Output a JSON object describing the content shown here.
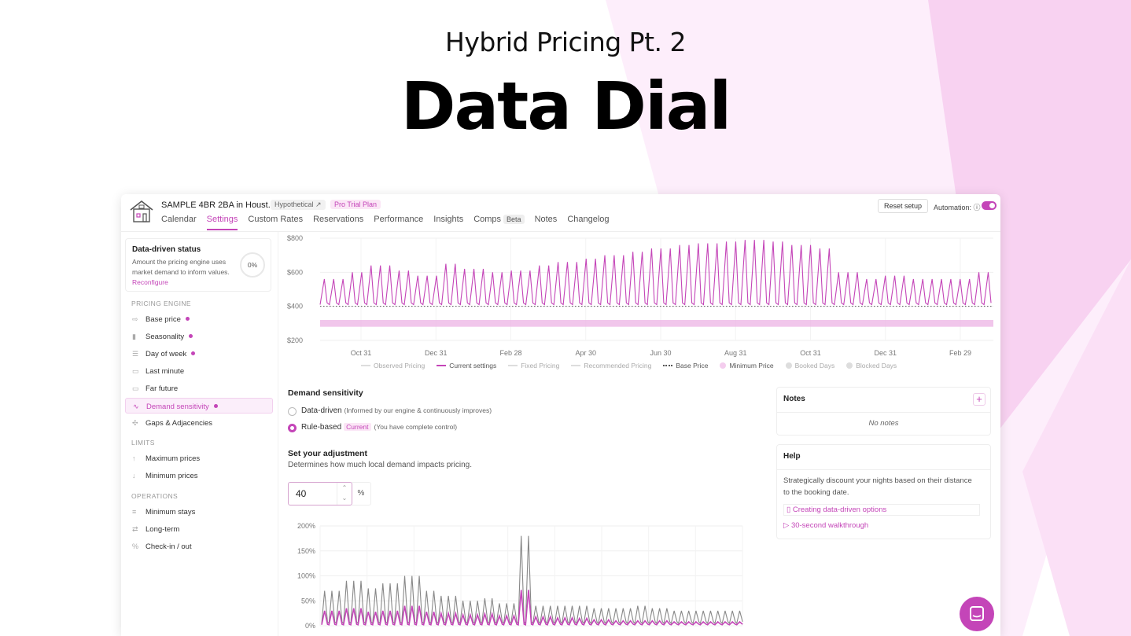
{
  "hero": {
    "subtitle": "Hybrid Pricing Pt. 2",
    "title": "Data Dial"
  },
  "colors": {
    "accent": "#c445b8",
    "accent_light": "#fbe6f6",
    "shape_light": "#fde8f8",
    "shape_mid": "#f7c8ef"
  },
  "header": {
    "property_title": "SAMPLE 4BR 2BA in Houst...",
    "badge_hypothetical": "Hypothetical",
    "badge_plan": "Pro Trial Plan",
    "reset_label": "Reset setup",
    "automation_label": "Automation:",
    "automation_on": true,
    "tabs": [
      {
        "label": "Calendar",
        "active": false
      },
      {
        "label": "Settings",
        "active": true
      },
      {
        "label": "Custom Rates",
        "active": false
      },
      {
        "label": "Reservations",
        "active": false
      },
      {
        "label": "Performance",
        "active": false
      },
      {
        "label": "Insights",
        "active": false
      },
      {
        "label": "Comps",
        "active": false,
        "badge": "Beta"
      },
      {
        "label": "Notes",
        "active": false
      },
      {
        "label": "Changelog",
        "active": false
      }
    ]
  },
  "sidebar": {
    "status": {
      "title": "Data-driven status",
      "description": "Amount the pricing engine uses market demand to inform values.",
      "link": "Reconfigure",
      "percent": "0%"
    },
    "sections": {
      "engine": "PRICING ENGINE",
      "limits": "LIMITS",
      "operations": "OPERATIONS"
    },
    "engine_items": [
      {
        "label": "Base price",
        "icon": "base-price-icon",
        "dot": true
      },
      {
        "label": "Seasonality",
        "icon": "seasonality-icon",
        "dot": true
      },
      {
        "label": "Day of week",
        "icon": "day-of-week-icon",
        "dot": true
      },
      {
        "label": "Last minute",
        "icon": "last-minute-icon",
        "dot": false
      },
      {
        "label": "Far future",
        "icon": "far-future-icon",
        "dot": false
      },
      {
        "label": "Demand sensitivity",
        "icon": "wave-icon",
        "dot": true,
        "active": true
      },
      {
        "label": "Gaps & Adjacencies",
        "icon": "gaps-icon",
        "dot": false
      }
    ],
    "limit_items": [
      {
        "label": "Maximum prices",
        "icon": "arrow-up-icon"
      },
      {
        "label": "Minimum prices",
        "icon": "arrow-down-icon"
      }
    ],
    "operation_items": [
      {
        "label": "Minimum stays",
        "icon": "list-icon"
      },
      {
        "label": "Long-term",
        "icon": "long-term-icon"
      },
      {
        "label": "Check-in / out",
        "icon": "percent-icon"
      }
    ]
  },
  "chart_data": [
    {
      "type": "line",
      "x_ticks": [
        "Oct 31",
        "Dec 31",
        "Feb 28",
        "Apr 30",
        "Jun 30",
        "Aug 31",
        "Oct 31",
        "Dec 31",
        "Feb 29"
      ],
      "y_ticks": [
        "$800",
        "$600",
        "$400",
        "$200"
      ],
      "ylim": [
        200,
        800
      ],
      "grid": true,
      "series": [
        {
          "name": "Current settings",
          "color": "#c445b8",
          "base": 400,
          "cycles": 72,
          "peaks": [
            560,
            600,
            640,
            610,
            580,
            650,
            620,
            600,
            610,
            640,
            660,
            680,
            700,
            720,
            740,
            760,
            770,
            780,
            790,
            780,
            760,
            740,
            600,
            560,
            580,
            560,
            560,
            560,
            600
          ]
        },
        {
          "name": "Base Price",
          "value": 400,
          "style": "dotted",
          "color": "#555555"
        },
        {
          "name": "Minimum Price",
          "band": [
            280,
            320
          ],
          "color": "#e9a6df"
        }
      ],
      "legend": [
        {
          "name": "Observed Pricing",
          "active": false
        },
        {
          "name": "Current settings",
          "active": true
        },
        {
          "name": "Fixed Pricing",
          "active": false
        },
        {
          "name": "Recommended Pricing",
          "active": false
        },
        {
          "name": "Base Price",
          "active": true
        },
        {
          "name": "Minimum Price",
          "active": true
        },
        {
          "name": "Booked Days",
          "active": false
        },
        {
          "name": "Blocked Days",
          "active": false
        }
      ]
    },
    {
      "type": "line",
      "y_ticks": [
        "200%",
        "150%",
        "100%",
        "50%",
        "0%"
      ],
      "ylim": [
        0,
        200
      ],
      "grid": true,
      "series": [
        {
          "name": "market demand",
          "color": "#888888",
          "cycles": 58,
          "peaks": [
            70,
            90,
            75,
            85,
            100,
            70,
            60,
            50,
            55,
            45,
            180,
            40,
            40,
            40,
            35,
            35,
            40,
            35,
            30,
            30,
            30,
            30
          ]
        },
        {
          "name": "adjustment",
          "color": "#c445b8",
          "cycles": 58,
          "peaks": [
            30,
            35,
            28,
            30,
            40,
            28,
            25,
            22,
            24,
            20,
            72,
            18,
            16,
            15,
            12,
            10,
            10,
            10,
            8,
            8,
            8,
            8
          ]
        }
      ]
    }
  ],
  "demand": {
    "title": "Demand sensitivity",
    "options": [
      {
        "label": "Data-driven",
        "note": "(Informed by our engine & continuously improves)",
        "checked": false
      },
      {
        "label": "Rule-based",
        "badge": "Current",
        "note": "(You have complete control)",
        "checked": true
      }
    ],
    "adjust_title": "Set your adjustment",
    "adjust_desc": "Determines how much local demand impacts pricing.",
    "value": "40",
    "unit": "%"
  },
  "notes": {
    "title": "Notes",
    "add_label": "+",
    "empty": "No notes"
  },
  "help": {
    "title": "Help",
    "body": "Strategically discount your nights based on their distance to the booking date.",
    "links": [
      "Creating data-driven options",
      "30-second walkthrough"
    ]
  }
}
